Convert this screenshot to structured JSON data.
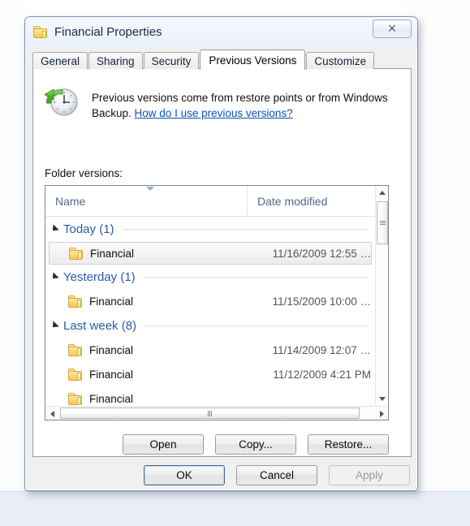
{
  "window": {
    "title": "Financial Properties",
    "folder_icon": "folder-icon",
    "close_icon": "✕"
  },
  "tabs": [
    {
      "label": "General",
      "active": false
    },
    {
      "label": "Sharing",
      "active": false
    },
    {
      "label": "Security",
      "active": false
    },
    {
      "label": "Previous Versions",
      "active": true
    },
    {
      "label": "Customize",
      "active": false
    }
  ],
  "description": {
    "icon": "clock-restore-icon",
    "text": "Previous versions come from restore points or from Windows Backup.",
    "link": "How do I use previous versions?"
  },
  "list": {
    "label": "Folder versions:",
    "columns": {
      "name": "Name",
      "date_modified": "Date modified"
    },
    "groups": [
      {
        "title": "Today (1)",
        "rows": [
          {
            "name": "Financial",
            "date": "11/16/2009 12:55 …",
            "selected": true
          }
        ]
      },
      {
        "title": "Yesterday (1)",
        "rows": [
          {
            "name": "Financial",
            "date": "11/15/2009 10:00 …",
            "selected": false
          }
        ]
      },
      {
        "title": "Last week (8)",
        "rows": [
          {
            "name": "Financial",
            "date": "11/14/2009 12:07 …",
            "selected": false
          },
          {
            "name": "Financial",
            "date": "11/12/2009 4:21 PM",
            "selected": false
          },
          {
            "name": "Financial",
            "date": "",
            "selected": false
          }
        ]
      }
    ]
  },
  "action_buttons": [
    {
      "label": "Open",
      "disabled": false
    },
    {
      "label": "Copy...",
      "disabled": false
    },
    {
      "label": "Restore...",
      "disabled": false
    }
  ],
  "footer_buttons": [
    {
      "label": "OK",
      "disabled": false,
      "default": true
    },
    {
      "label": "Cancel",
      "disabled": false,
      "default": false
    },
    {
      "label": "Apply",
      "disabled": true,
      "default": false
    }
  ]
}
